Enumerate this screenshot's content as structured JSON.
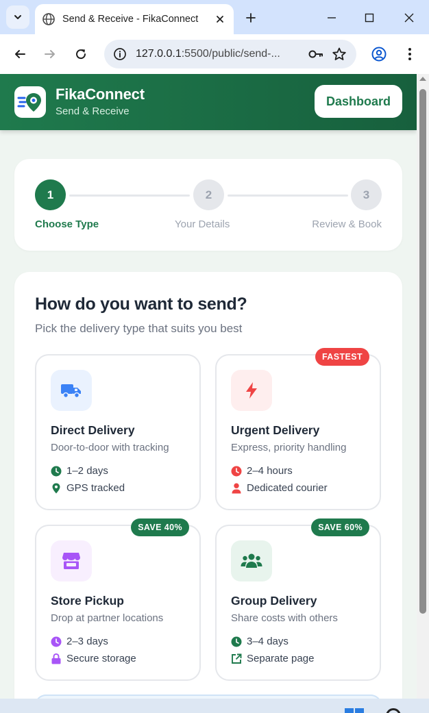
{
  "browser": {
    "tab_title": "Send & Receive - FikaConnect",
    "url_host": "127.0.0.1",
    "url_path": ":5500/public/send-..."
  },
  "header": {
    "brand": "FikaConnect",
    "subtitle": "Send & Receive",
    "dashboard_label": "Dashboard"
  },
  "stepper": {
    "steps": [
      {
        "number": "1",
        "label": "Choose Type",
        "state": "active"
      },
      {
        "number": "2",
        "label": "Your Details",
        "state": "pending"
      },
      {
        "number": "3",
        "label": "Review & Book",
        "state": "pending"
      }
    ]
  },
  "main": {
    "title": "How do you want to send?",
    "subtitle": "Pick the delivery type that suits you best",
    "options": [
      {
        "title": "Direct Delivery",
        "description": "Door-to-door with tracking",
        "badge": "",
        "icon": "truck-icon",
        "meta": [
          {
            "icon": "clock-icon",
            "text": "1–2 days"
          },
          {
            "icon": "map-pin-icon",
            "text": "GPS tracked"
          }
        ]
      },
      {
        "title": "Urgent Delivery",
        "description": "Express, priority handling",
        "badge": "FASTEST",
        "icon": "bolt-icon",
        "meta": [
          {
            "icon": "clock-icon",
            "text": "2–4 hours"
          },
          {
            "icon": "user-icon",
            "text": "Dedicated courier"
          }
        ]
      },
      {
        "title": "Store Pickup",
        "description": "Drop at partner locations",
        "badge": "SAVE 40%",
        "icon": "store-icon",
        "meta": [
          {
            "icon": "clock-icon",
            "text": "2–3 days"
          },
          {
            "icon": "lock-icon",
            "text": "Secure storage"
          }
        ]
      },
      {
        "title": "Group Delivery",
        "description": "Share costs with others",
        "badge": "SAVE 60%",
        "icon": "users-icon",
        "meta": [
          {
            "icon": "clock-icon",
            "text": "3–4 days"
          },
          {
            "icon": "external-link-icon",
            "text": "Separate page"
          }
        ]
      }
    ]
  },
  "colors": {
    "brand_green": "#1f7a4d",
    "urgent_red": "#ef4444",
    "direct_blue": "#3b82f6",
    "store_purple": "#a855f7"
  }
}
